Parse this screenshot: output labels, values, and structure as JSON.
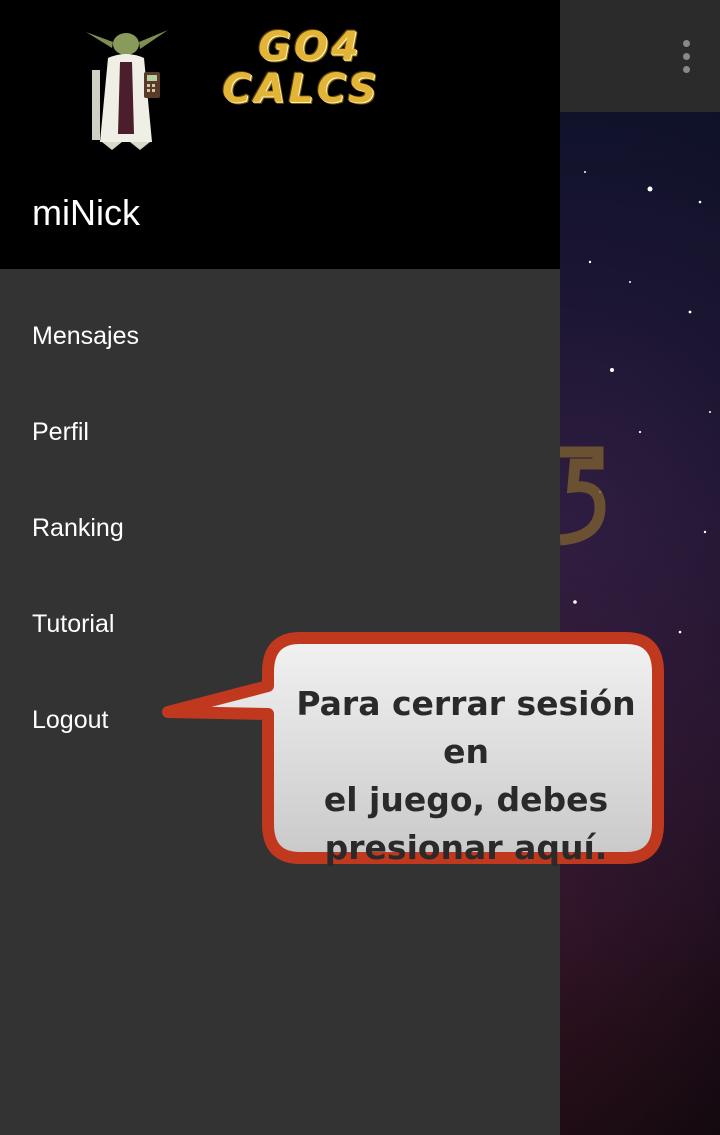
{
  "drawer": {
    "nickname": "miNick",
    "logo_line1": "GO4",
    "logo_line2": "CALCS",
    "menu": [
      {
        "label": "Mensajes"
      },
      {
        "label": "Perfil"
      },
      {
        "label": "Ranking"
      },
      {
        "label": "Tutorial"
      },
      {
        "label": "Logout"
      }
    ]
  },
  "callout": {
    "text_line1": "Para cerrar sesión en",
    "text_line2": "el juego, debes",
    "text_line3": "presionar aquí."
  },
  "icons": {
    "overflow": "more-vert-icon",
    "mascot": "yoda-mascot"
  },
  "colors": {
    "drawer_bg": "#333333",
    "header_bg": "#000000",
    "callout_border": "#c0391e",
    "logo_gold": "#e2b437"
  }
}
